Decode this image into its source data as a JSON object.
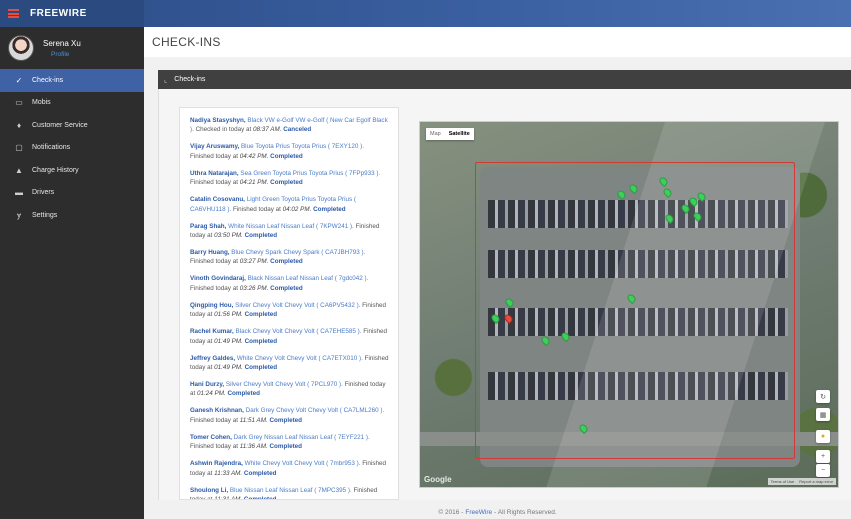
{
  "brand": "FREEWIRE",
  "user": {
    "name": "Serena Xu",
    "role": "Profile"
  },
  "nav": [
    {
      "label": "Check-ins",
      "icon": "check-icon",
      "glyph": "✓",
      "active": true
    },
    {
      "label": "Mobis",
      "icon": "vehicle-icon",
      "glyph": "▭",
      "active": false
    },
    {
      "label": "Customer Service",
      "icon": "flame-icon",
      "glyph": "♦",
      "active": false
    },
    {
      "label": "Notifications",
      "icon": "chat-icon",
      "glyph": "▢",
      "active": false
    },
    {
      "label": "Charge History",
      "icon": "car-icon",
      "glyph": "▲",
      "active": false
    },
    {
      "label": "Drivers",
      "icon": "id-card-icon",
      "glyph": "▬",
      "active": false
    },
    {
      "label": "Settings",
      "icon": "fork-icon",
      "glyph": "ɏ",
      "active": false
    }
  ],
  "page_title": "CHECK-INS",
  "panel_title": "Check-ins",
  "checkins": [
    {
      "who": "Nadiya Stasyshyn,",
      "car": "Black VW e-Golf VW e-Golf ( New Car Egolf Black ).",
      "mid": "Checked in today at",
      "time": "08:37 AM.",
      "status": "Canceled"
    },
    {
      "who": "Vijay Aruswamy,",
      "car": "Blue Toyota Prius Toyota Prius ( 7EXY120 ).",
      "mid": "Finished today at",
      "time": "04:42 PM.",
      "status": "Completed"
    },
    {
      "who": "Uthra Natarajan,",
      "car": "Sea Green Toyota Prius Toyota Prius ( 7FPp933 ).",
      "mid": "Finished today at",
      "time": "04:21 PM.",
      "status": "Completed"
    },
    {
      "who": "Catalin Cosovanu,",
      "car": "Light Green Toyota Prius Toyota Prius ( CA6VHU118 ).",
      "mid": "Finished today at",
      "time": "04:02 PM.",
      "status": "Completed"
    },
    {
      "who": "Parag Shah,",
      "car": "White Nissan Leaf Nissan Leaf ( 7KPW241 ).",
      "mid": "Finished today at",
      "time": "03:50 PM.",
      "status": "Completed"
    },
    {
      "who": "Barry Huang,",
      "car": "Blue Chevy Spark Chevy Spark ( CA7JBH793 ).",
      "mid": "Finished today at",
      "time": "03:27 PM.",
      "status": "Completed"
    },
    {
      "who": "Vinoth Govindaraj,",
      "car": "Black Nissan Leaf Nissan Leaf ( 7gdc042 ).",
      "mid": "Finished today at",
      "time": "03:26 PM.",
      "status": "Completed"
    },
    {
      "who": "Qingping Hou,",
      "car": "Silver Chevy Volt Chevy Volt ( CA6PV5432 ).",
      "mid": "Finished today at",
      "time": "01:56 PM.",
      "status": "Completed"
    },
    {
      "who": "Rachel Kumar,",
      "car": "Black Chevy Volt Chevy Volt ( CA7EHE585 ).",
      "mid": "Finished today at",
      "time": "01:49 PM.",
      "status": "Completed"
    },
    {
      "who": "Jeffrey Galdes,",
      "car": "White Chevy Volt Chevy Volt ( CA7ETX010 ).",
      "mid": "Finished today at",
      "time": "01:49 PM.",
      "status": "Completed"
    },
    {
      "who": "Hani Durzy,",
      "car": "Silver Chevy Volt Chevy Volt ( 7PCL970 ).",
      "mid": "Finished today at",
      "time": "01:24 PM.",
      "status": "Completed"
    },
    {
      "who": "Ganesh Krishnan,",
      "car": "Dark Grey Chevy Volt Chevy Volt ( CA7LML260 ).",
      "mid": "Finished today at",
      "time": "11:51 AM.",
      "status": "Completed"
    },
    {
      "who": "Tomer Cohen,",
      "car": "Dark Grey Nissan Leaf Nissan Leaf ( 7EYF221 ).",
      "mid": "Finished today at",
      "time": "11:36 AM.",
      "status": "Completed"
    },
    {
      "who": "Ashwin Rajendra,",
      "car": "White Chevy Volt Chevy Volt ( 7mbr953 ).",
      "mid": "Finished today at",
      "time": "11:33 AM.",
      "status": "Completed"
    },
    {
      "who": "Shoulong Li,",
      "car": "Blue Nissan Leaf Nissan Leaf ( 7MPC395 ).",
      "mid": "Finished today at",
      "time": "11:31 AM.",
      "status": "Completed"
    }
  ],
  "map": {
    "tab_map": "Map",
    "tab_satellite": "Satellite",
    "watermark": "Google",
    "terms": "Terms of Use",
    "report": "Report a map error",
    "zoom_in": "+",
    "zoom_out": "−"
  },
  "footer": {
    "prefix": "© 2016 -",
    "link": "FreeWire",
    "suffix": "- All Rights Reserved."
  }
}
